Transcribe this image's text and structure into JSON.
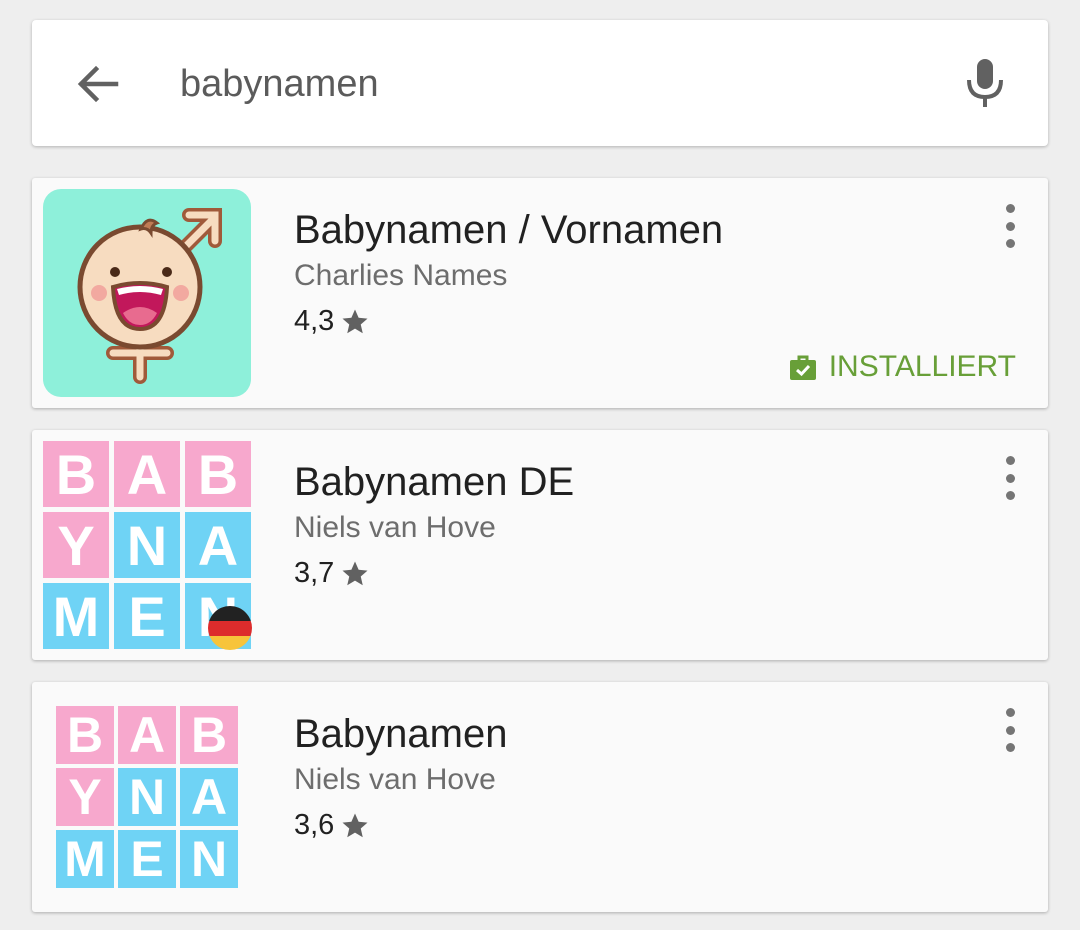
{
  "search": {
    "query": "babynamen",
    "back_icon": "arrow-back-icon",
    "mic_icon": "microphone-icon"
  },
  "results": [
    {
      "title": "Babynamen / Vornamen",
      "developer": "Charlies Names",
      "rating": "4,3",
      "installed_label": "INSTALLIERT",
      "icon": "baby-face-gender-symbol-icon",
      "icon_bg": "#8ef0da"
    },
    {
      "title": "Babynamen DE",
      "developer": "Niels van Hove",
      "rating": "3,7",
      "icon": "babynamen-letter-grid-with-german-flag-icon",
      "tiles": [
        "B",
        "A",
        "B",
        "Y",
        "N",
        "A",
        "M",
        "E",
        "N"
      ]
    },
    {
      "title": "Babynamen",
      "developer": "Niels van Hove",
      "rating": "3,6",
      "icon": "babynamen-letter-grid-icon",
      "tiles": [
        "B",
        "A",
        "B",
        "Y",
        "N",
        "A",
        "M",
        "E",
        "N"
      ]
    }
  ],
  "colors": {
    "installed": "#689f38",
    "title": "#212121",
    "developer": "#6d6d6d",
    "tile_pink": "#f7a8cd",
    "tile_blue": "#6fd3f5"
  }
}
